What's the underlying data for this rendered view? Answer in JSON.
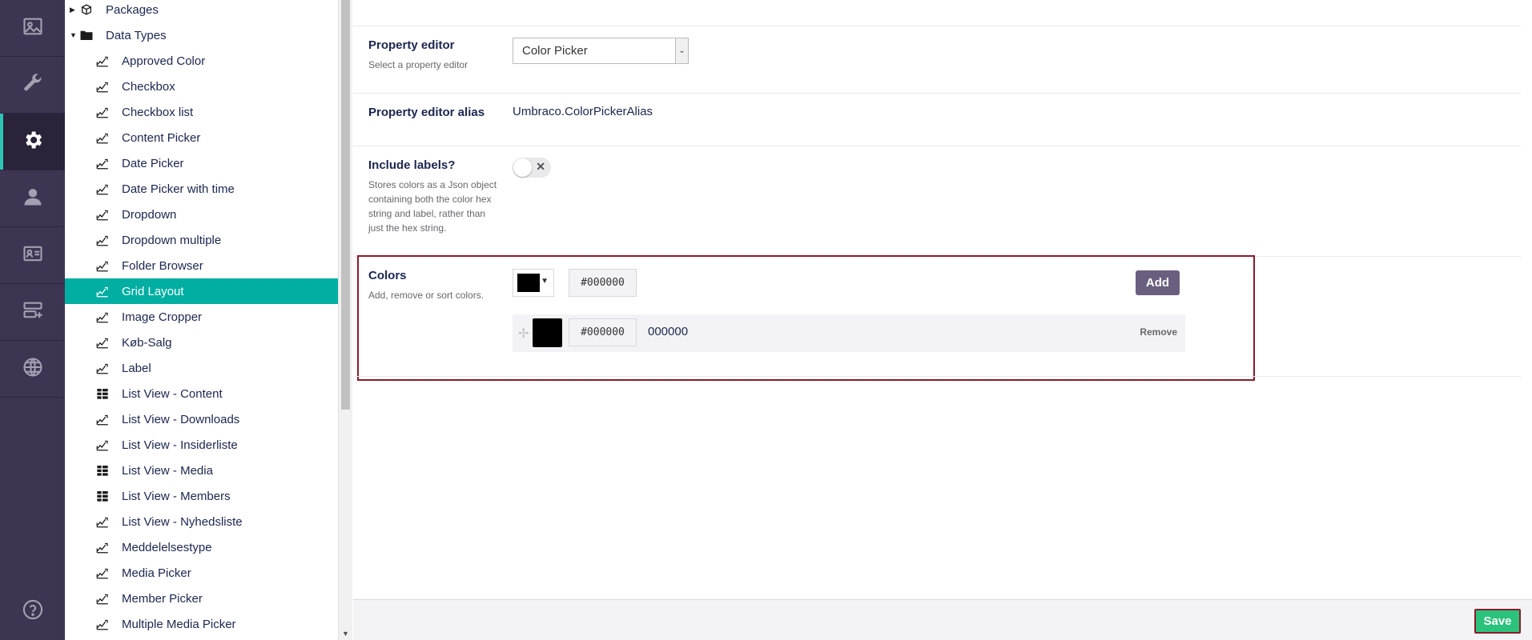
{
  "rail": {
    "items": [
      {
        "icon": "media-icon"
      },
      {
        "icon": "wrench-icon"
      },
      {
        "icon": "gear-icon"
      },
      {
        "icon": "user-icon"
      },
      {
        "icon": "member-card-icon"
      },
      {
        "icon": "forms-icon"
      },
      {
        "icon": "globe-icon"
      }
    ],
    "help_icon": "help-icon"
  },
  "tree": {
    "top_items": [
      {
        "label": "Packages",
        "icon": "package-icon",
        "expanded": false
      },
      {
        "label": "Data Types",
        "icon": "folder-icon",
        "expanded": true
      }
    ],
    "children": [
      {
        "label": "Approved Color",
        "icon": "datatype-icon"
      },
      {
        "label": "Checkbox",
        "icon": "datatype-icon"
      },
      {
        "label": "Checkbox list",
        "icon": "datatype-icon"
      },
      {
        "label": "Content Picker",
        "icon": "datatype-icon"
      },
      {
        "label": "Date Picker",
        "icon": "datatype-icon"
      },
      {
        "label": "Date Picker with time",
        "icon": "datatype-icon"
      },
      {
        "label": "Dropdown",
        "icon": "datatype-icon"
      },
      {
        "label": "Dropdown multiple",
        "icon": "datatype-icon"
      },
      {
        "label": "Folder Browser",
        "icon": "datatype-icon"
      },
      {
        "label": "Grid Layout",
        "icon": "datatype-icon",
        "selected": true
      },
      {
        "label": "Image Cropper",
        "icon": "datatype-icon"
      },
      {
        "label": "Køb-Salg",
        "icon": "datatype-icon"
      },
      {
        "label": "Label",
        "icon": "datatype-icon"
      },
      {
        "label": "List View - Content",
        "icon": "listview-icon"
      },
      {
        "label": "List View - Downloads",
        "icon": "datatype-icon"
      },
      {
        "label": "List View - Insiderliste",
        "icon": "datatype-icon"
      },
      {
        "label": "List View - Media",
        "icon": "listview-icon"
      },
      {
        "label": "List View - Members",
        "icon": "listview-icon"
      },
      {
        "label": "List View - Nyhedsliste",
        "icon": "datatype-icon"
      },
      {
        "label": "Meddelelsestype",
        "icon": "datatype-icon"
      },
      {
        "label": "Media Picker",
        "icon": "datatype-icon"
      },
      {
        "label": "Member Picker",
        "icon": "datatype-icon"
      },
      {
        "label": "Multiple Media Picker",
        "icon": "datatype-icon"
      }
    ]
  },
  "editor": {
    "property_editor_label": "Property editor",
    "property_editor_desc": "Select a property editor",
    "property_editor_value": "Color Picker",
    "alias_label": "Property editor alias",
    "alias_value": "Umbraco.ColorPickerAlias",
    "include_labels_label": "Include labels?",
    "include_labels_desc": "Stores colors as a Json object containing both the color hex string and label, rather than just the hex string.",
    "include_labels_on": false,
    "colors_label": "Colors",
    "colors_desc": "Add, remove or sort colors.",
    "new_color_hex": "#000000",
    "new_color": "#000000",
    "add_label": "Add",
    "color_items": [
      {
        "color": "#000000",
        "hex": "#000000",
        "label": "000000",
        "remove_label": "Remove"
      }
    ]
  },
  "footer": {
    "save_label": "Save"
  },
  "colors": {
    "rail_bg": "#3e3552",
    "selected_tree": "#00aea2",
    "save_green": "#2bc37c",
    "add_purple": "#6a5f7f",
    "highlight_border": "#8b1a2c"
  }
}
